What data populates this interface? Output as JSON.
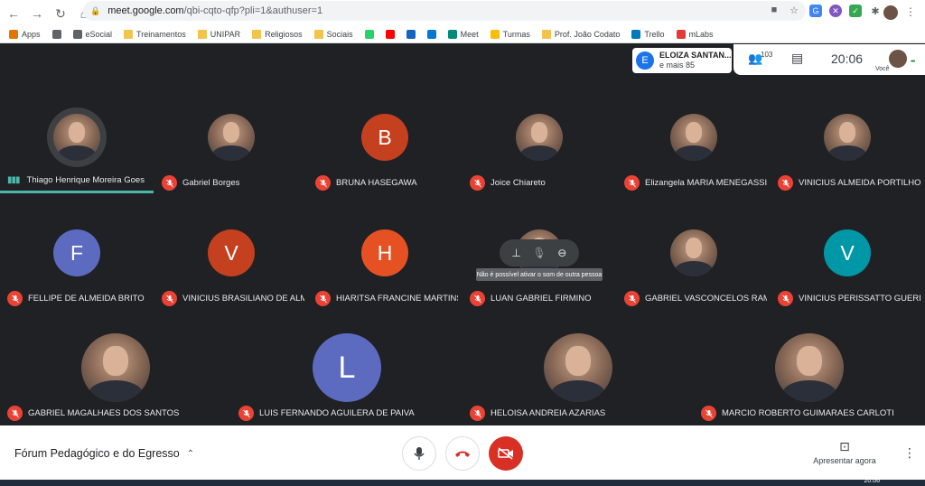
{
  "browser": {
    "url_host": "meet.google.com",
    "url_path": "/qbi-cqto-qfp?pli=1&authuser=1",
    "bookmarks": [
      {
        "label": "Apps",
        "color": "#e37400"
      },
      {
        "label": "",
        "color": "#5f6368"
      },
      {
        "label": "eSocial",
        "color": "#5f6368"
      },
      {
        "label": "Treinamentos",
        "color": "folder"
      },
      {
        "label": "UNIPAR",
        "color": "folder"
      },
      {
        "label": "Religiosos",
        "color": "folder"
      },
      {
        "label": "Sociais",
        "color": "folder"
      },
      {
        "label": "",
        "color": "#25d366"
      },
      {
        "label": "",
        "color": "#ff0000"
      },
      {
        "label": "",
        "color": "#1565c0"
      },
      {
        "label": "",
        "color": "#0078d4"
      },
      {
        "label": "Meet",
        "color": "#00897b"
      },
      {
        "label": "Turmas",
        "color": "#fbbc04"
      },
      {
        "label": "Prof. João Codato",
        "color": "folder"
      },
      {
        "label": "Trello",
        "color": "#0079bf"
      },
      {
        "label": "mLabs",
        "color": "#e53935"
      }
    ]
  },
  "topbar": {
    "presenter_initial": "E",
    "presenter_name": "ELOIZA SANTAN...",
    "presenter_more": "e mais 85",
    "people_count": "103",
    "clock": "20:06",
    "self_label": "Você"
  },
  "participants": [
    {
      "name": "Thiago Henrique Moreira Goes",
      "type": "photo",
      "speaking": true
    },
    {
      "name": "Gabriel Borges",
      "type": "photo"
    },
    {
      "name": "BRUNA HASEGAWA",
      "type": "letter",
      "letter": "B",
      "color": "#c5401f"
    },
    {
      "name": "Joice Chiareto",
      "type": "photo"
    },
    {
      "name": "Elizangela MARIA MENEGASSI D...",
      "type": "photo"
    },
    {
      "name": "VINICIUS ALMEIDA PORTILHO",
      "type": "photo"
    },
    {
      "name": "FELLIPE DE ALMEIDA BRITO",
      "type": "letter",
      "letter": "F",
      "color": "#5c6bc0"
    },
    {
      "name": "VINICIUS BRASILIANO DE ALME...",
      "type": "letter",
      "letter": "V",
      "color": "#c5401f"
    },
    {
      "name": "HIARITSA FRANCINE MARTINS ...",
      "type": "letter",
      "letter": "H",
      "color": "#e65124"
    },
    {
      "name": "LUAN GABRIEL FIRMINO",
      "type": "photo"
    },
    {
      "name": "GABRIEL VASCONCELOS RAMOS",
      "type": "photo"
    },
    {
      "name": "VINICIUS PERISSATTO GUERREI...",
      "type": "letter",
      "letter": "V",
      "color": "#0097a7"
    },
    {
      "name": "GABRIEL MAGALHAES DOS SANTOS",
      "type": "photo"
    },
    {
      "name": "LUIS FERNANDO AGUILERA DE PAIVA",
      "type": "letter",
      "letter": "L",
      "color": "#5c6bc0"
    },
    {
      "name": "HELOISA ANDREIA AZARIAS",
      "type": "photo"
    },
    {
      "name": "MARCIO ROBERTO GUIMARAES CARLOTI",
      "type": "photo"
    }
  ],
  "hover": {
    "tooltip": "Não é possível ativar o som de outra pessoa"
  },
  "bottombar": {
    "meeting_title": "Fórum Pedagógico e do Egresso",
    "present_label": "Apresentar agora"
  },
  "taskbar": {
    "time": "20:06"
  }
}
